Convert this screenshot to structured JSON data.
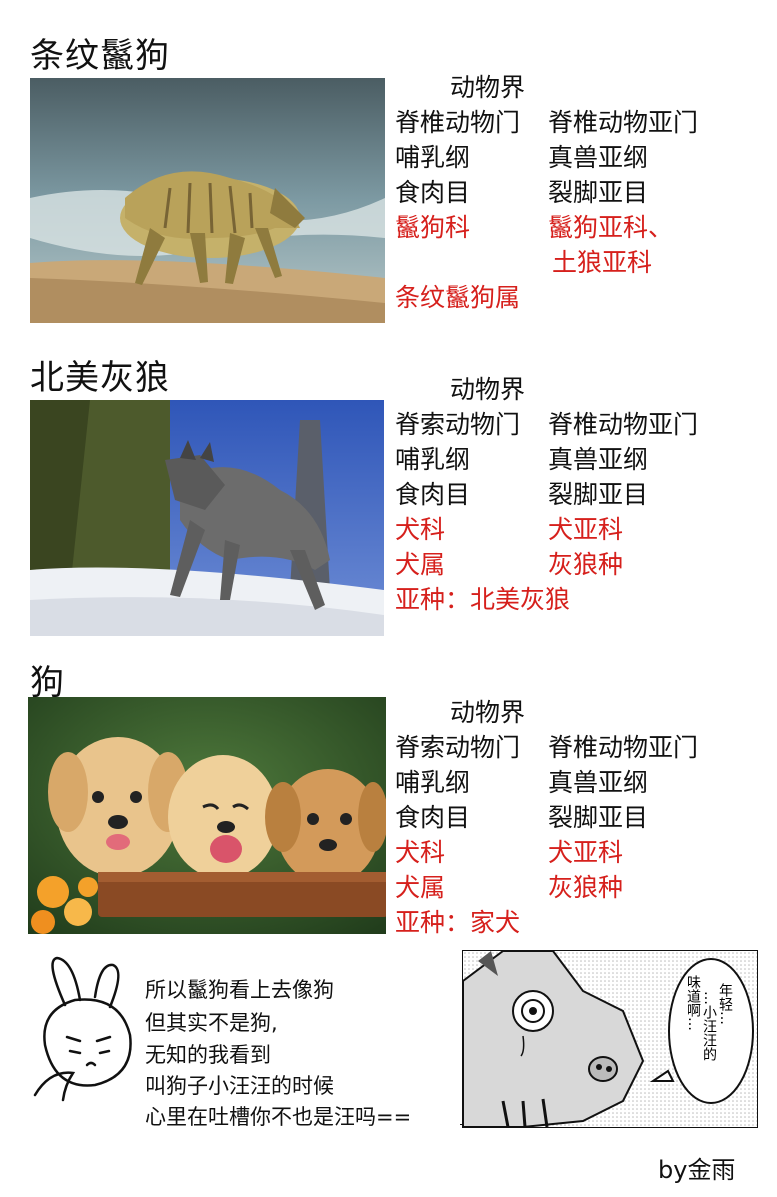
{
  "sections": [
    {
      "title": "条纹鬣狗",
      "kingdom": "动物界",
      "rows": [
        {
          "left": "脊椎动物门",
          "right": "脊椎动物亚门"
        },
        {
          "left": "哺乳纲",
          "right": "真兽亚纲"
        },
        {
          "left": "食肉目",
          "right": "裂脚亚目"
        },
        {
          "left": "鬣狗科",
          "right": "鬣狗亚科、"
        }
      ],
      "extra_right": "土狼亚科",
      "last_line": "条纹鬣狗属"
    },
    {
      "title": "北美灰狼",
      "kingdom": "动物界",
      "rows": [
        {
          "left": "脊索动物门",
          "right": "脊椎动物亚门"
        },
        {
          "left": "哺乳纲",
          "right": "真兽亚纲"
        },
        {
          "left": "食肉目",
          "right": "裂脚亚目"
        },
        {
          "left": "犬科",
          "right": "犬亚科"
        },
        {
          "left": "犬属",
          "right": "灰狼种"
        }
      ],
      "last_line": "亚种：北美灰狼"
    },
    {
      "title": "狗",
      "kingdom": "动物界",
      "rows": [
        {
          "left": "脊索动物门",
          "right": "脊椎动物亚门"
        },
        {
          "left": "哺乳纲",
          "right": "真兽亚纲"
        },
        {
          "left": "食肉目",
          "right": "裂脚亚目"
        },
        {
          "left": "犬科",
          "right": "犬亚科"
        },
        {
          "left": "犬属",
          "right": "灰狼种"
        }
      ],
      "last_line": "亚种：家犬"
    }
  ],
  "comment": {
    "lines": [
      "所以鬣狗看上去像狗",
      "但其实不是狗,",
      "无知的我看到",
      "叫狗子小汪汪的时候",
      "心里在吐槽你不也是汪吗=="
    ]
  },
  "manga": {
    "bubble_col1": "年轻…",
    "bubble_col2": "…小汪汪的",
    "bubble_col3": "味道啊…"
  },
  "byline": "by金雨",
  "colors": {
    "accent_red": "#d6201c",
    "text": "#111111"
  },
  "icons": [
    "hyena-photo",
    "wolf-photo",
    "puppies-photo",
    "bunny-doodle-icon",
    "manga-pig-panel"
  ]
}
